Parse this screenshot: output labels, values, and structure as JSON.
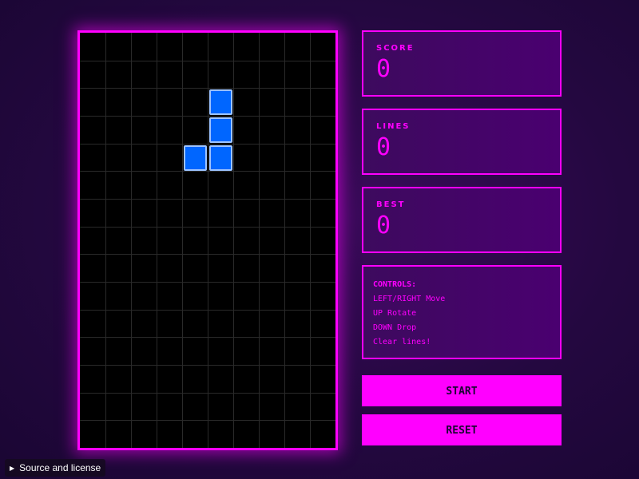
{
  "board": {
    "columns": 10,
    "rows": 15,
    "grid_color": "#2a2a2a",
    "border_color": "#ff00ff",
    "active_piece": {
      "shape": "J",
      "color": "#0066ff",
      "cells": [
        [
          5,
          2
        ],
        [
          5,
          3
        ],
        [
          4,
          4
        ],
        [
          5,
          4
        ]
      ]
    }
  },
  "stats": {
    "score": {
      "label": "SCORE",
      "value": "0"
    },
    "lines": {
      "label": "LINES",
      "value": "0"
    },
    "best": {
      "label": "BEST",
      "value": "0"
    }
  },
  "controls": {
    "title": "CONTROLS:",
    "lines": [
      "LEFT/RIGHT Move",
      "UP Rotate",
      "DOWN Drop",
      "Clear lines!"
    ]
  },
  "buttons": {
    "start": "START",
    "reset": "RESET"
  },
  "footer": {
    "source_label": "Source and license"
  },
  "colors": {
    "accent": "#ff00ff",
    "background": "#240840"
  }
}
